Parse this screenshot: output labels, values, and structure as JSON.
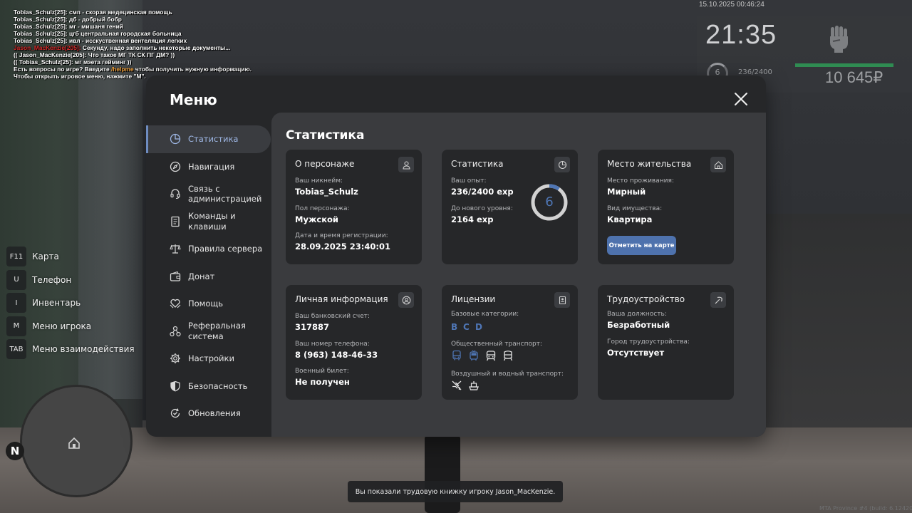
{
  "chat": [
    {
      "parts": [
        {
          "text": "Tobias_Schulz[25]: смп - скорая медецинская помощь",
          "color": "white"
        }
      ]
    },
    {
      "parts": [
        {
          "text": "Tobias_Schulz[25]: дб - добрый бобр",
          "color": "white"
        }
      ]
    },
    {
      "parts": [
        {
          "text": "Tobias_Schulz[25]: мг - мишаня гений",
          "color": "white"
        }
      ]
    },
    {
      "parts": [
        {
          "text": "Tobias_Schulz[25]: цгб центральная городская больница",
          "color": "white"
        }
      ]
    },
    {
      "parts": [
        {
          "text": "Tobias_Schulz[25]: ивл - исскуственная вентеляция легких",
          "color": "white"
        }
      ]
    },
    {
      "parts": [
        {
          "text": "Jason_MacKenzie[205]: ",
          "color": "red"
        },
        {
          "text": "Секунду, надо заполнить некоторые документы...",
          "color": "white"
        }
      ]
    },
    {
      "parts": [
        {
          "text": "(( Jason_MacKenzie[205]: Что такое МГ ТК СК ПГ ДМ? ))",
          "color": "white"
        }
      ]
    },
    {
      "parts": [
        {
          "text": "(( Tobias_Schulz[25]: мг мэета гейминг ))",
          "color": "white"
        }
      ]
    },
    {
      "parts": [
        {
          "text": "Есть вопросы по игре? Введите ",
          "color": "white"
        },
        {
          "text": "/helpme",
          "color": "orange"
        },
        {
          "text": " чтобы получить нужную информацию.",
          "color": "white"
        }
      ]
    },
    {
      "parts": [
        {
          "text": "Чтобы открыть игровое меню, нажмите \"M\".",
          "color": "white"
        }
      ]
    }
  ],
  "hud": {
    "datetime": "15.10.2025 00:46:24",
    "time": "21:35",
    "level": "6",
    "exp": "236/2400",
    "money": "10 645₽",
    "level_progress": 0.098
  },
  "hints": [
    {
      "key": "F11",
      "label": "Карта",
      "name": "hint-map"
    },
    {
      "key": "U",
      "label": "Телефон",
      "name": "hint-phone"
    },
    {
      "key": "I",
      "label": "Инвентарь",
      "name": "hint-inventory"
    },
    {
      "key": "M",
      "label": "Меню игрока",
      "name": "hint-player-menu"
    },
    {
      "key": "TAB",
      "label": "Меню взаимодействия",
      "name": "hint-interaction-menu"
    }
  ],
  "minimap": {
    "north": "N"
  },
  "menu": {
    "title": "Меню",
    "nav": [
      {
        "label": "Статистика",
        "icon": "pie-chart-icon",
        "name": "nav-statistics",
        "active": true
      },
      {
        "label": "Навигация",
        "icon": "compass-icon",
        "name": "nav-navigation",
        "active": false
      },
      {
        "label": "Связь с администрацией",
        "icon": "headset-icon",
        "name": "nav-admin-contact",
        "active": false
      },
      {
        "label": "Команды и клавиши",
        "icon": "document-icon",
        "name": "nav-commands",
        "active": false
      },
      {
        "label": "Правила сервера",
        "icon": "scales-icon",
        "name": "nav-rules",
        "active": false
      },
      {
        "label": "Донат",
        "icon": "wallet-icon",
        "name": "nav-donate",
        "active": false
      },
      {
        "label": "Помощь",
        "icon": "heart-hands-icon",
        "name": "nav-help",
        "active": false
      },
      {
        "label": "Реферальная система",
        "icon": "referral-icon",
        "name": "nav-referral",
        "active": false
      },
      {
        "label": "Настройки",
        "icon": "gear-icon",
        "name": "nav-settings",
        "active": false
      },
      {
        "label": "Безопасность",
        "icon": "shield-icon",
        "name": "nav-security",
        "active": false
      },
      {
        "label": "Обновления",
        "icon": "update-icon",
        "name": "nav-updates",
        "active": false
      }
    ]
  },
  "content": {
    "title": "Статистика",
    "character": {
      "title": "О персонаже",
      "nickname_label": "Ваш никнейм:",
      "nickname": "Tobias_Schulz",
      "gender_label": "Пол персонажа:",
      "gender": "Мужской",
      "reg_label": "Дата и время регистрации:",
      "reg": "28.09.2025 23:40:01"
    },
    "stats": {
      "title": "Статистика",
      "exp_label": "Ваш опыт:",
      "exp": "236/2400 exp",
      "next_label": "До нового уровня:",
      "next": "2164 exp",
      "level": "6",
      "progress": 0.098
    },
    "residence": {
      "title": "Место жительства",
      "place_label": "Место проживания:",
      "place": "Мирный",
      "type_label": "Вид имущества:",
      "type": "Квартира",
      "button": "Отметить на карте"
    },
    "personal": {
      "title": "Личная информация",
      "bank_label": "Ваш банковский счет:",
      "bank": "317887",
      "phone_label": "Ваш номер телефона:",
      "phone": "8 (963) 148-46-33",
      "military_label": "Военный билет:",
      "military": "Не получен"
    },
    "licenses": {
      "title": "Лицензии",
      "base_label": "Базовые категории:",
      "categories": [
        "B",
        "C",
        "D"
      ],
      "public_label": "Общественный транспорт:",
      "public_icons": [
        "bus-icon",
        "trolleybus-icon",
        "tram-icon",
        "metro-icon"
      ],
      "air_label": "Воздушный и водный транспорт:",
      "air_icons": [
        "plane-icon",
        "ship-icon"
      ]
    },
    "employment": {
      "title": "Трудоустройство",
      "position_label": "Ваша должность:",
      "position": "Безработный",
      "city_label": "Город трудоустройства:",
      "city": "Отсутствует"
    }
  },
  "toast": "Вы показали трудовую книжку игроку Jason_MacKenzie.",
  "build": "MTA Province #4 (build: 6.12420.9",
  "colors": {
    "accent": "#4f76b5",
    "hud_bar": "#2f8c52",
    "chat_red": "#d42a2a",
    "chat_orange": "#f0a03c"
  }
}
